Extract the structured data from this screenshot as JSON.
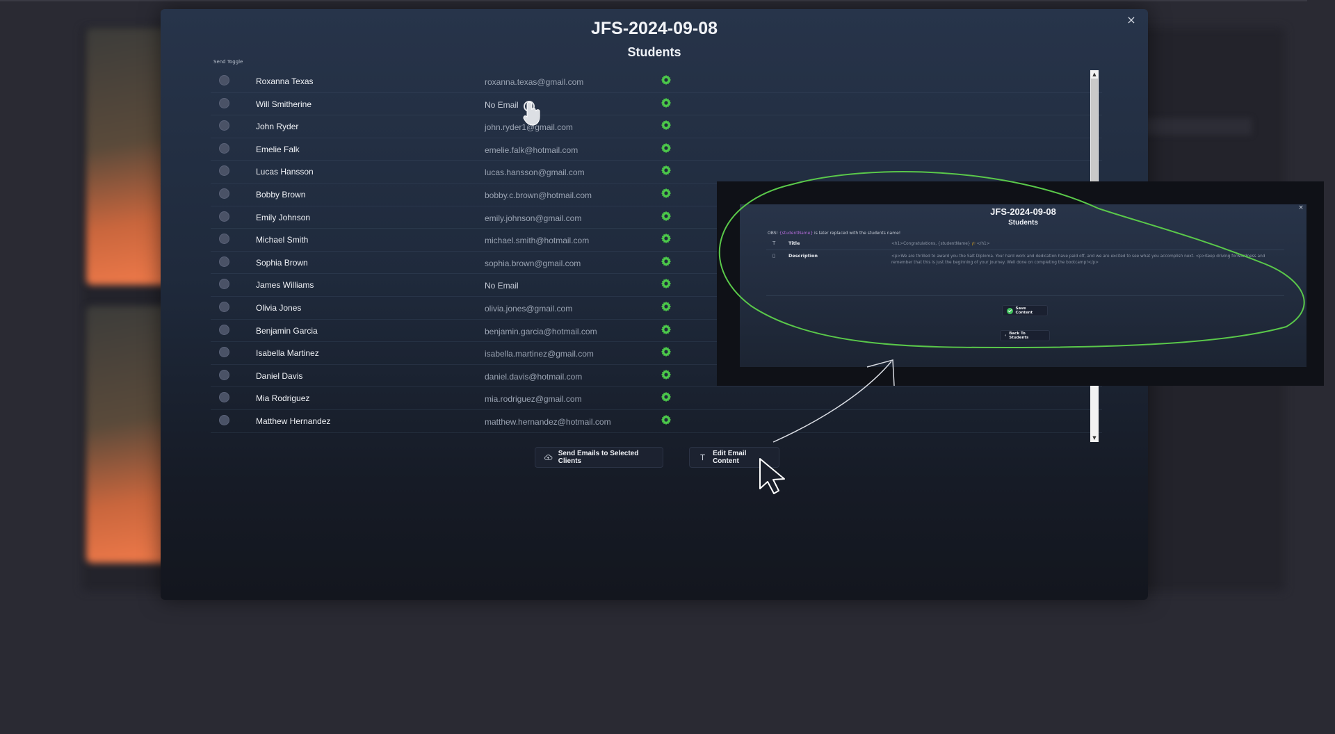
{
  "modal": {
    "title": "JFS-2024-09-08",
    "subtitle": "Students",
    "close_label": "×",
    "send_toggle_label": "Send Toggle"
  },
  "students": [
    {
      "name": "Roxanna Texas",
      "email": "roxanna.texas@gmail.com"
    },
    {
      "name": "Will Smitherine",
      "email": "No Email"
    },
    {
      "name": "John Ryder",
      "email": "john.ryder1@gmail.com"
    },
    {
      "name": "Emelie Falk",
      "email": "emelie.falk@hotmail.com"
    },
    {
      "name": "Lucas Hansson",
      "email": "lucas.hansson@gmail.com"
    },
    {
      "name": "Bobby Brown",
      "email": "bobby.c.brown@hotmail.com"
    },
    {
      "name": "Emily Johnson",
      "email": "emily.johnson@gmail.com"
    },
    {
      "name": "Michael Smith",
      "email": "michael.smith@hotmail.com"
    },
    {
      "name": "Sophia Brown",
      "email": "sophia.brown@gmail.com"
    },
    {
      "name": "James Williams",
      "email": "No Email"
    },
    {
      "name": "Olivia Jones",
      "email": "olivia.jones@gmail.com"
    },
    {
      "name": "Benjamin Garcia",
      "email": "benjamin.garcia@hotmail.com"
    },
    {
      "name": "Isabella Martinez",
      "email": "isabella.martinez@gmail.com"
    },
    {
      "name": "Daniel Davis",
      "email": "daniel.davis@hotmail.com"
    },
    {
      "name": "Mia Rodriguez",
      "email": "mia.rodriguez@gmail.com"
    },
    {
      "name": "Matthew Hernandez",
      "email": "matthew.hernandez@hotmail.com"
    }
  ],
  "buttons": {
    "send_emails": "Send Emails to Selected Clients",
    "edit_email": "Edit Email Content"
  },
  "inset": {
    "title": "JFS-2024-09-08",
    "subtitle": "Students",
    "close_label": "×",
    "note_prefix": "OBS! ",
    "note_placeholder": "{studentName}",
    "note_suffix": " is later replaced with the students name!",
    "title_label": "Title",
    "title_value": "<h1>Congratulations, {studentName} 🎓</h1>",
    "description_label": "Description",
    "description_value": "<p>We are thrilled to award you the Salt Diploma. Your hard work and dedication have paid off, and we are excited to see what you accomplish next. <p>Keep driving forwardness and remember that this is just the beginning of your journey. Well done on completing the bootcamp!</p>",
    "save_label": "Save Content",
    "back_label": "Back To Students"
  },
  "colors": {
    "gear": "#4cc94a",
    "annotation": "#5ac84a",
    "arrow": "#d8dbe2"
  }
}
